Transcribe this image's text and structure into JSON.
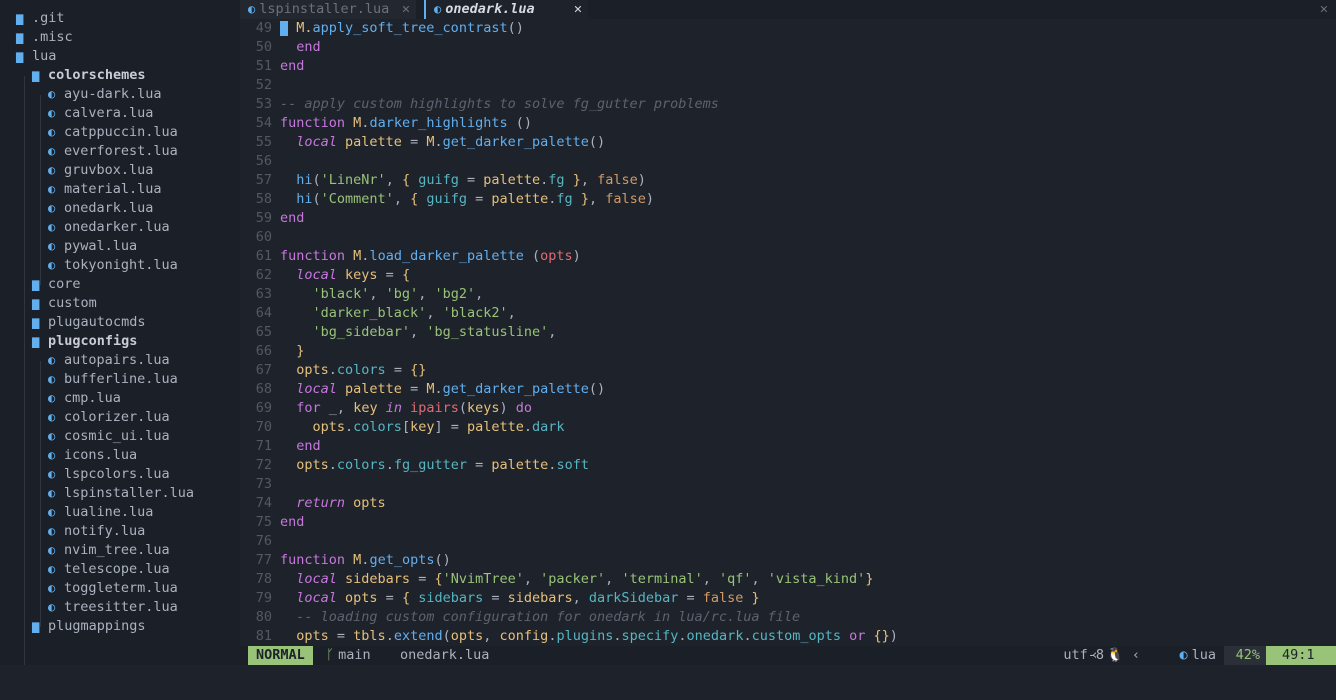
{
  "tabs": [
    {
      "label": "lspinstaller.lua",
      "close": "✕",
      "active": false
    },
    {
      "label": "onedark.lua",
      "close": "✕",
      "active": true
    }
  ],
  "window_close": "✕",
  "tree": [
    {
      "name": ".git",
      "type": "dir",
      "depth": 0
    },
    {
      "name": ".misc",
      "type": "dir",
      "depth": 0
    },
    {
      "name": "lua",
      "type": "dir",
      "depth": 0
    },
    {
      "name": "colorschemes",
      "type": "dir",
      "depth": 1,
      "bold": true
    },
    {
      "name": "ayu-dark.lua",
      "type": "file",
      "depth": 2
    },
    {
      "name": "calvera.lua",
      "type": "file",
      "depth": 2
    },
    {
      "name": "catppuccin.lua",
      "type": "file",
      "depth": 2
    },
    {
      "name": "everforest.lua",
      "type": "file",
      "depth": 2
    },
    {
      "name": "gruvbox.lua",
      "type": "file",
      "depth": 2
    },
    {
      "name": "material.lua",
      "type": "file",
      "depth": 2
    },
    {
      "name": "onedark.lua",
      "type": "file",
      "depth": 2
    },
    {
      "name": "onedarker.lua",
      "type": "file",
      "depth": 2
    },
    {
      "name": "pywal.lua",
      "type": "file",
      "depth": 2
    },
    {
      "name": "tokyonight.lua",
      "type": "file",
      "depth": 2
    },
    {
      "name": "core",
      "type": "dir",
      "depth": 1
    },
    {
      "name": "custom",
      "type": "dir",
      "depth": 1
    },
    {
      "name": "plugautocmds",
      "type": "dir",
      "depth": 1
    },
    {
      "name": "plugconfigs",
      "type": "dir",
      "depth": 1,
      "bold": true
    },
    {
      "name": "autopairs.lua",
      "type": "file",
      "depth": 2
    },
    {
      "name": "bufferline.lua",
      "type": "file",
      "depth": 2
    },
    {
      "name": "cmp.lua",
      "type": "file",
      "depth": 2
    },
    {
      "name": "colorizer.lua",
      "type": "file",
      "depth": 2
    },
    {
      "name": "cosmic_ui.lua",
      "type": "file",
      "depth": 2
    },
    {
      "name": "icons.lua",
      "type": "file",
      "depth": 2
    },
    {
      "name": "lspcolors.lua",
      "type": "file",
      "depth": 2
    },
    {
      "name": "lspinstaller.lua",
      "type": "file",
      "depth": 2
    },
    {
      "name": "lualine.lua",
      "type": "file",
      "depth": 2
    },
    {
      "name": "notify.lua",
      "type": "file",
      "depth": 2
    },
    {
      "name": "nvim_tree.lua",
      "type": "file",
      "depth": 2
    },
    {
      "name": "telescope.lua",
      "type": "file",
      "depth": 2
    },
    {
      "name": "toggleterm.lua",
      "type": "file",
      "depth": 2
    },
    {
      "name": "treesitter.lua",
      "type": "file",
      "depth": 2
    },
    {
      "name": "plugmappings",
      "type": "dir",
      "depth": 1
    }
  ],
  "code": [
    {
      "n": "49",
      "cursor": true,
      "t": [
        [
          "  M.",
          "tk-var"
        ],
        [
          "apply_soft_tree_contrast",
          "tk-fn"
        ],
        [
          "()",
          "tk-punc"
        ]
      ]
    },
    {
      "n": "50",
      "t": [
        [
          "  end",
          "tk-kw"
        ]
      ]
    },
    {
      "n": "51",
      "t": [
        [
          "end",
          "tk-kw"
        ]
      ]
    },
    {
      "n": "52",
      "t": []
    },
    {
      "n": "53",
      "t": [
        [
          "-- apply custom highlights to solve fg_gutter problems",
          "tk-cmt"
        ]
      ]
    },
    {
      "n": "54",
      "t": [
        [
          "function ",
          "tk-kw"
        ],
        [
          "M",
          "tk-var"
        ],
        [
          ".",
          "tk-punc"
        ],
        [
          "darker_highlights",
          "tk-fn"
        ],
        [
          " ()",
          "tk-punc"
        ]
      ]
    },
    {
      "n": "55",
      "t": [
        [
          "  local ",
          "tk-kwi"
        ],
        [
          "palette",
          "tk-var"
        ],
        [
          " = ",
          "tk-punc"
        ],
        [
          "M",
          "tk-var"
        ],
        [
          ".",
          "tk-punc"
        ],
        [
          "get_darker_palette",
          "tk-fn"
        ],
        [
          "()",
          "tk-punc"
        ]
      ]
    },
    {
      "n": "56",
      "t": []
    },
    {
      "n": "57",
      "t": [
        [
          "  hi",
          "tk-fn"
        ],
        [
          "(",
          "tk-punc"
        ],
        [
          "'LineNr'",
          "tk-str"
        ],
        [
          ", ",
          "tk-punc"
        ],
        [
          "{ ",
          "tk-brace"
        ],
        [
          "guifg",
          "tk-field"
        ],
        [
          " = ",
          "tk-punc"
        ],
        [
          "palette",
          "tk-var"
        ],
        [
          ".",
          "tk-punc"
        ],
        [
          "fg",
          "tk-field"
        ],
        [
          " }",
          "tk-brace"
        ],
        [
          ", ",
          "tk-punc"
        ],
        [
          "false",
          "tk-bool"
        ],
        [
          ")",
          "tk-punc"
        ]
      ]
    },
    {
      "n": "58",
      "t": [
        [
          "  hi",
          "tk-fn"
        ],
        [
          "(",
          "tk-punc"
        ],
        [
          "'Comment'",
          "tk-str"
        ],
        [
          ", ",
          "tk-punc"
        ],
        [
          "{ ",
          "tk-brace"
        ],
        [
          "guifg",
          "tk-field"
        ],
        [
          " = ",
          "tk-punc"
        ],
        [
          "palette",
          "tk-var"
        ],
        [
          ".",
          "tk-punc"
        ],
        [
          "fg",
          "tk-field"
        ],
        [
          " }",
          "tk-brace"
        ],
        [
          ", ",
          "tk-punc"
        ],
        [
          "false",
          "tk-bool"
        ],
        [
          ")",
          "tk-punc"
        ]
      ]
    },
    {
      "n": "59",
      "t": [
        [
          "end",
          "tk-kw"
        ]
      ]
    },
    {
      "n": "60",
      "t": []
    },
    {
      "n": "61",
      "t": [
        [
          "function ",
          "tk-kw"
        ],
        [
          "M",
          "tk-var"
        ],
        [
          ".",
          "tk-punc"
        ],
        [
          "load_darker_palette",
          "tk-fn"
        ],
        [
          " (",
          "tk-punc"
        ],
        [
          "opts",
          "tk-prop"
        ],
        [
          ")",
          "tk-punc"
        ]
      ]
    },
    {
      "n": "62",
      "t": [
        [
          "  local ",
          "tk-kwi"
        ],
        [
          "keys",
          "tk-var"
        ],
        [
          " = ",
          "tk-punc"
        ],
        [
          "{",
          "tk-brace"
        ]
      ]
    },
    {
      "n": "63",
      "t": [
        [
          "    'black'",
          "tk-str"
        ],
        [
          ", ",
          "tk-punc"
        ],
        [
          "'bg'",
          "tk-str"
        ],
        [
          ", ",
          "tk-punc"
        ],
        [
          "'bg2'",
          "tk-str"
        ],
        [
          ",",
          "tk-punc"
        ]
      ]
    },
    {
      "n": "64",
      "t": [
        [
          "    'darker_black'",
          "tk-str"
        ],
        [
          ", ",
          "tk-punc"
        ],
        [
          "'black2'",
          "tk-str"
        ],
        [
          ",",
          "tk-punc"
        ]
      ]
    },
    {
      "n": "65",
      "t": [
        [
          "    'bg_sidebar'",
          "tk-str"
        ],
        [
          ", ",
          "tk-punc"
        ],
        [
          "'bg_statusline'",
          "tk-str"
        ],
        [
          ",",
          "tk-punc"
        ]
      ]
    },
    {
      "n": "66",
      "t": [
        [
          "  }",
          "tk-brace"
        ]
      ]
    },
    {
      "n": "67",
      "t": [
        [
          "  opts",
          "tk-var"
        ],
        [
          ".",
          "tk-punc"
        ],
        [
          "colors",
          "tk-field"
        ],
        [
          " = ",
          "tk-punc"
        ],
        [
          "{}",
          "tk-brace"
        ]
      ]
    },
    {
      "n": "68",
      "t": [
        [
          "  local ",
          "tk-kwi"
        ],
        [
          "palette",
          "tk-var"
        ],
        [
          " = ",
          "tk-punc"
        ],
        [
          "M",
          "tk-var"
        ],
        [
          ".",
          "tk-punc"
        ],
        [
          "get_darker_palette",
          "tk-fn"
        ],
        [
          "()",
          "tk-punc"
        ]
      ]
    },
    {
      "n": "69",
      "t": [
        [
          "  for ",
          "tk-kw"
        ],
        [
          "_",
          "tk-plain"
        ],
        [
          ", ",
          "tk-punc"
        ],
        [
          "key",
          "tk-var"
        ],
        [
          " in ",
          "tk-kwi"
        ],
        [
          "ipairs",
          "tk-prop"
        ],
        [
          "(",
          "tk-punc"
        ],
        [
          "keys",
          "tk-var"
        ],
        [
          ") ",
          "tk-punc"
        ],
        [
          "do",
          "tk-kw"
        ]
      ]
    },
    {
      "n": "70",
      "t": [
        [
          "    opts",
          "tk-var"
        ],
        [
          ".",
          "tk-punc"
        ],
        [
          "colors",
          "tk-field"
        ],
        [
          "[",
          "tk-punc"
        ],
        [
          "key",
          "tk-var"
        ],
        [
          "] = ",
          "tk-punc"
        ],
        [
          "palette",
          "tk-var"
        ],
        [
          ".",
          "tk-punc"
        ],
        [
          "dark",
          "tk-field"
        ]
      ]
    },
    {
      "n": "71",
      "t": [
        [
          "  end",
          "tk-kw"
        ]
      ]
    },
    {
      "n": "72",
      "t": [
        [
          "  opts",
          "tk-var"
        ],
        [
          ".",
          "tk-punc"
        ],
        [
          "colors",
          "tk-field"
        ],
        [
          ".",
          "tk-punc"
        ],
        [
          "fg_gutter",
          "tk-field"
        ],
        [
          " = ",
          "tk-punc"
        ],
        [
          "palette",
          "tk-var"
        ],
        [
          ".",
          "tk-punc"
        ],
        [
          "soft",
          "tk-field"
        ]
      ]
    },
    {
      "n": "73",
      "t": []
    },
    {
      "n": "74",
      "t": [
        [
          "  return ",
          "tk-kwi"
        ],
        [
          "opts",
          "tk-var"
        ]
      ]
    },
    {
      "n": "75",
      "t": [
        [
          "end",
          "tk-kw"
        ]
      ]
    },
    {
      "n": "76",
      "t": []
    },
    {
      "n": "77",
      "t": [
        [
          "function ",
          "tk-kw"
        ],
        [
          "M",
          "tk-var"
        ],
        [
          ".",
          "tk-punc"
        ],
        [
          "get_opts",
          "tk-fn"
        ],
        [
          "()",
          "tk-punc"
        ]
      ]
    },
    {
      "n": "78",
      "t": [
        [
          "  local ",
          "tk-kwi"
        ],
        [
          "sidebars",
          "tk-var"
        ],
        [
          " = ",
          "tk-punc"
        ],
        [
          "{",
          "tk-brace"
        ],
        [
          "'NvimTree'",
          "tk-str"
        ],
        [
          ", ",
          "tk-punc"
        ],
        [
          "'packer'",
          "tk-str"
        ],
        [
          ", ",
          "tk-punc"
        ],
        [
          "'terminal'",
          "tk-str"
        ],
        [
          ", ",
          "tk-punc"
        ],
        [
          "'qf'",
          "tk-str"
        ],
        [
          ", ",
          "tk-punc"
        ],
        [
          "'vista_kind'",
          "tk-str"
        ],
        [
          "}",
          "tk-brace"
        ]
      ]
    },
    {
      "n": "79",
      "t": [
        [
          "  local ",
          "tk-kwi"
        ],
        [
          "opts",
          "tk-var"
        ],
        [
          " = ",
          "tk-punc"
        ],
        [
          "{ ",
          "tk-brace"
        ],
        [
          "sidebars",
          "tk-field"
        ],
        [
          " = ",
          "tk-punc"
        ],
        [
          "sidebars",
          "tk-var"
        ],
        [
          ", ",
          "tk-punc"
        ],
        [
          "darkSidebar",
          "tk-field"
        ],
        [
          " = ",
          "tk-punc"
        ],
        [
          "false",
          "tk-bool"
        ],
        [
          " }",
          "tk-brace"
        ]
      ]
    },
    {
      "n": "80",
      "t": [
        [
          "  -- loading custom configuration for onedark in lua/rc.lua file",
          "tk-cmt"
        ]
      ]
    },
    {
      "n": "81",
      "t": [
        [
          "  opts",
          "tk-var"
        ],
        [
          " = ",
          "tk-punc"
        ],
        [
          "tbls",
          "tk-var"
        ],
        [
          ".",
          "tk-punc"
        ],
        [
          "extend",
          "tk-fn"
        ],
        [
          "(",
          "tk-punc"
        ],
        [
          "opts",
          "tk-var"
        ],
        [
          ", ",
          "tk-punc"
        ],
        [
          "config",
          "tk-var"
        ],
        [
          ".",
          "tk-punc"
        ],
        [
          "plugins",
          "tk-field"
        ],
        [
          ".",
          "tk-punc"
        ],
        [
          "specify",
          "tk-field"
        ],
        [
          ".",
          "tk-punc"
        ],
        [
          "onedark",
          "tk-field"
        ],
        [
          ".",
          "tk-punc"
        ],
        [
          "custom_opts",
          "tk-field"
        ],
        [
          " or ",
          "tk-kw"
        ],
        [
          "{}",
          "tk-brace"
        ],
        [
          ")",
          "tk-punc"
        ]
      ]
    }
  ],
  "status": {
    "mode": "NORMAL",
    "branch_icon": "ᚴ",
    "branch": "main",
    "filename": "onedark.lua",
    "encoding": "utf-8",
    "os_icon": "🐧",
    "filetype": "lua",
    "percent": "42%",
    "position": "49:1"
  }
}
